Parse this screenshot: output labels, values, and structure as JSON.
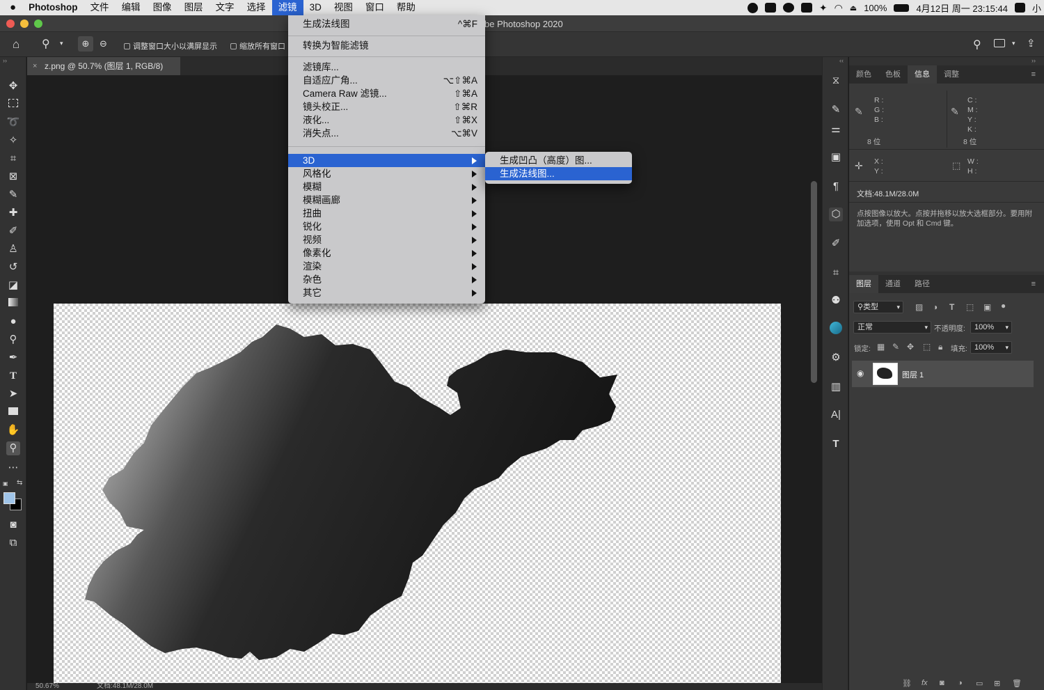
{
  "menubar": {
    "apple_icon": "apple-logo-icon",
    "app_name": "Photoshop",
    "items": [
      "文件",
      "编辑",
      "图像",
      "图层",
      "文字",
      "选择",
      "滤镜",
      "3D",
      "视图",
      "窗口",
      "帮助"
    ],
    "active_item": "滤镜",
    "battery": "100%",
    "datetime": "4月12日 周一 23:15:44",
    "trailing": "小"
  },
  "titlebar": {
    "title": "be Photoshop 2020"
  },
  "options": {
    "fit_label": "调整窗口大小以满屏显示",
    "zoom_all_label": "缩放所有窗口"
  },
  "document": {
    "tab_title": "z.png @ 50.7% (图层 1, RGB/8)",
    "zoom": "50.67%",
    "doc_size": "文档:48.1M/28.0M"
  },
  "filter_menu": {
    "items": [
      {
        "label": "生成法线图",
        "shortcut": "^⌘F"
      },
      {
        "label": "转换为智能滤镜",
        "shortcut": ""
      },
      {
        "label": "滤镜库...",
        "shortcut": ""
      },
      {
        "label": "自适应广角...",
        "shortcut": "⌥⇧⌘A"
      },
      {
        "label": "Camera Raw 滤镜...",
        "shortcut": "⇧⌘A"
      },
      {
        "label": "镜头校正...",
        "shortcut": "⇧⌘R"
      },
      {
        "label": "液化...",
        "shortcut": "⇧⌘X"
      },
      {
        "label": "消失点...",
        "shortcut": "⌥⌘V"
      }
    ],
    "submenus": [
      "3D",
      "风格化",
      "模糊",
      "模糊画廊",
      "扭曲",
      "锐化",
      "视频",
      "像素化",
      "渲染",
      "杂色",
      "其它"
    ],
    "highlighted": "3D"
  },
  "submenu_3d": {
    "items": [
      "生成凹凸（高度）图...",
      "生成法线图..."
    ],
    "highlighted": "生成法线图..."
  },
  "info_panel": {
    "tabs": [
      "颜色",
      "色板",
      "信息",
      "调整"
    ],
    "active_tab": "信息",
    "rgb_labels": [
      "R :",
      "G :",
      "B :"
    ],
    "cmyk_labels": [
      "C :",
      "M :",
      "Y :",
      "K :"
    ],
    "bits_left": "8 位",
    "bits_right": "8 位",
    "xy_labels": [
      "X :",
      "Y :"
    ],
    "wh_labels": [
      "W :",
      "H :"
    ],
    "doc_size": "文档:48.1M/28.0M",
    "hint": "点按图像以放大。点按并拖移以放大选框部分。要用附加选项，使用 Opt 和 Cmd 键。"
  },
  "layers_panel": {
    "tabs": [
      "图层",
      "通道",
      "路径"
    ],
    "active_tab": "图层",
    "filter_kind": "类型",
    "blend_mode": "正常",
    "opacity_label": "不透明度:",
    "opacity": "100%",
    "lock_label": "锁定:",
    "fill_label": "填充:",
    "fill": "100%",
    "layers": [
      {
        "name": "图层 1",
        "visible": true
      }
    ]
  },
  "colors": {
    "accent": "#2a63d1",
    "menu_bg": "#c9c9cb",
    "panel_bg": "#323232",
    "fg_swatch": "#9fc4e8",
    "bg_swatch": "#000000"
  }
}
